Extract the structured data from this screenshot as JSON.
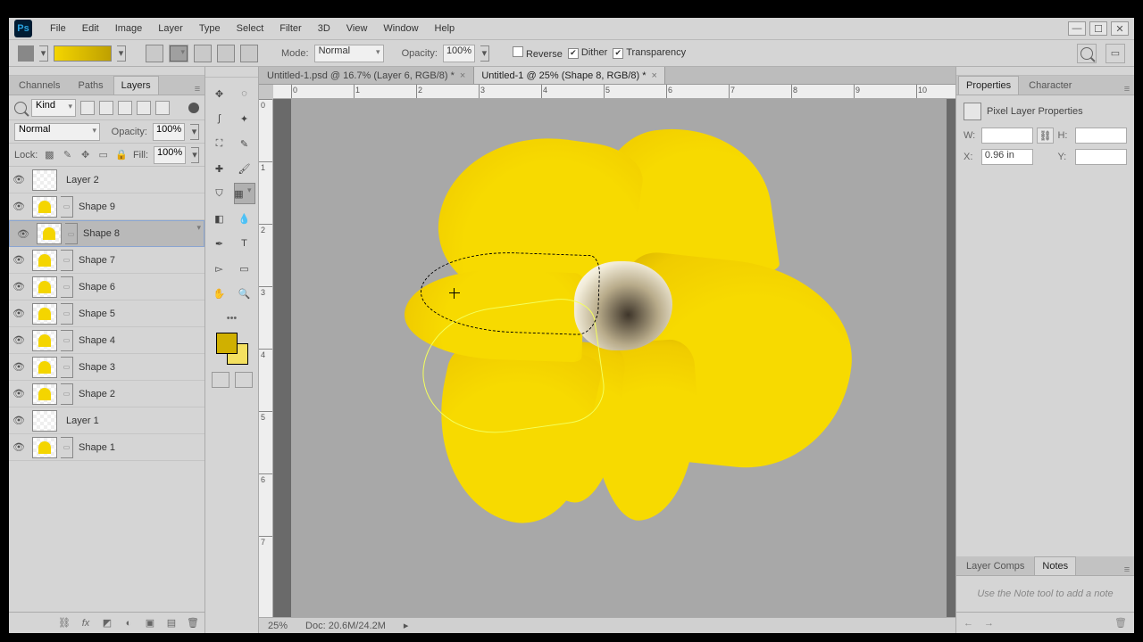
{
  "menu": [
    "File",
    "Edit",
    "Image",
    "Layer",
    "Type",
    "Select",
    "Filter",
    "3D",
    "View",
    "Window",
    "Help"
  ],
  "optionsBar": {
    "modeLabel": "Mode:",
    "modeValue": "Normal",
    "opacityLabel": "Opacity:",
    "opacityValue": "100%",
    "reverse": {
      "label": "Reverse",
      "checked": false
    },
    "dither": {
      "label": "Dither",
      "checked": true
    },
    "transparency": {
      "label": "Transparency",
      "checked": true
    }
  },
  "leftPanel": {
    "tabs": [
      "Channels",
      "Paths",
      "Layers"
    ],
    "activeTab": 2,
    "filterKind": "Kind",
    "blendMode": "Normal",
    "blendOpacityLabel": "Opacity:",
    "blendOpacityValue": "100%",
    "lockLabel": "Lock:",
    "fillLabel": "Fill:",
    "fillValue": "100%",
    "layers": [
      {
        "name": "Layer 2",
        "selected": false,
        "shape": false
      },
      {
        "name": "Shape 9",
        "selected": false,
        "shape": true
      },
      {
        "name": "Shape 8",
        "selected": true,
        "shape": true
      },
      {
        "name": "Shape 7",
        "selected": false,
        "shape": true
      },
      {
        "name": "Shape 6",
        "selected": false,
        "shape": true
      },
      {
        "name": "Shape 5",
        "selected": false,
        "shape": true
      },
      {
        "name": "Shape 4",
        "selected": false,
        "shape": true
      },
      {
        "name": "Shape 3",
        "selected": false,
        "shape": true
      },
      {
        "name": "Shape 2",
        "selected": false,
        "shape": true
      },
      {
        "name": "Layer 1",
        "selected": false,
        "shape": false
      },
      {
        "name": "Shape 1",
        "selected": false,
        "shape": true
      }
    ]
  },
  "docTabs": [
    {
      "title": "Untitled-1.psd @ 16.7% (Layer 6, RGB/8) *",
      "active": false
    },
    {
      "title": "Untitled-1 @ 25% (Shape 8, RGB/8) *",
      "active": true
    }
  ],
  "rulerH": [
    "0",
    "1",
    "2",
    "3",
    "4",
    "5",
    "6",
    "7",
    "8",
    "9",
    "10"
  ],
  "rulerV": [
    "0",
    "1",
    "2",
    "3",
    "4",
    "5",
    "6",
    "7"
  ],
  "statusBar": {
    "zoom": "25%",
    "docInfo": "Doc: 20.6M/24.2M"
  },
  "rightPanel": {
    "tabs1": [
      "Properties",
      "Character"
    ],
    "activeTab1": 0,
    "propsTitle": "Pixel Layer Properties",
    "W": {
      "label": "W:",
      "value": ""
    },
    "H": {
      "label": "H:",
      "value": ""
    },
    "X": {
      "label": "X:",
      "value": "0.96 in"
    },
    "Y": {
      "label": "Y:",
      "value": ""
    },
    "tabs2": [
      "Layer Comps",
      "Notes"
    ],
    "activeTab2": 1,
    "notesHint": "Use the Note tool to add a note"
  },
  "colors": {
    "fg": "#d0b000",
    "bg": "#f4e060",
    "gradientStart": "#f4d500",
    "gradientEnd": "#bfa000"
  }
}
